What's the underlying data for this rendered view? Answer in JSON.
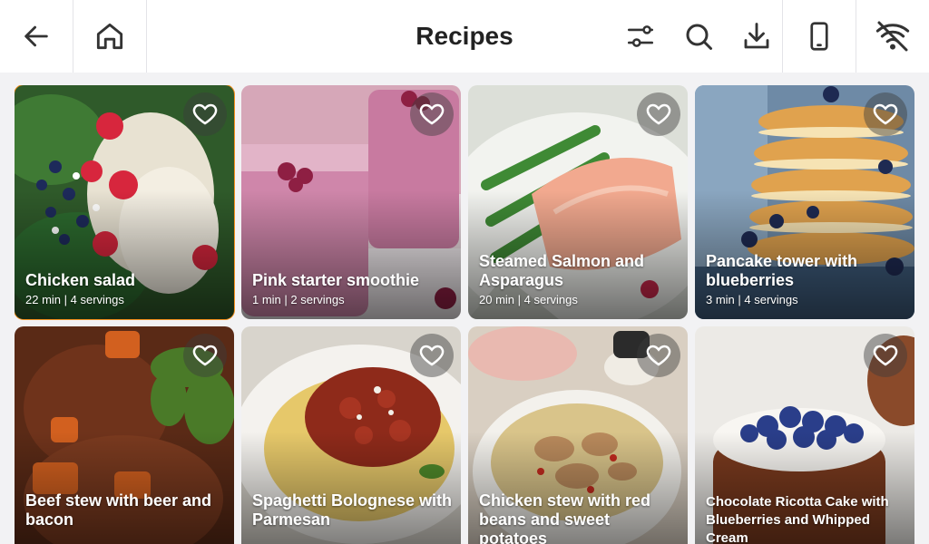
{
  "header": {
    "title": "Recipes",
    "icons": [
      "back-arrow-icon",
      "home-icon",
      "filter-sliders-icon",
      "search-icon",
      "download-icon",
      "device-icon",
      "wifi-off-icon"
    ]
  },
  "recipes": [
    {
      "name": "Chicken salad",
      "meta": "22 min | 4 servings",
      "selected": true
    },
    {
      "name": "Pink starter smoothie",
      "meta": "1 min | 2 servings"
    },
    {
      "name": "Steamed Salmon and Asparagus",
      "meta": "20 min | 4 servings"
    },
    {
      "name": "Pancake tower with blueberries",
      "meta": "3 min | 4 servings"
    },
    {
      "name": "Beef stew with beer and bacon"
    },
    {
      "name": "Spaghetti Bolognese with Parmesan"
    },
    {
      "name": "Chicken stew with red beans and sweet potatoes"
    },
    {
      "name": "Chocolate Ricotta Cake with Blueberries and Whipped Cream"
    }
  ],
  "colors": {
    "accent": "#f4901e",
    "background": "#f2f2f4",
    "header": "#ffffff"
  }
}
